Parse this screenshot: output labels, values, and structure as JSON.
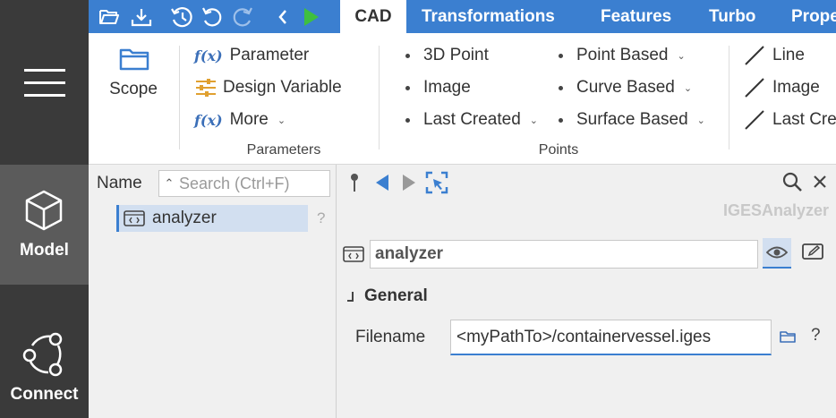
{
  "rail": {
    "model_label": "Model",
    "connect_label": "Connect"
  },
  "tabs": [
    {
      "label": "CAD"
    },
    {
      "label": "Transformations"
    },
    {
      "label": "Features"
    },
    {
      "label": "Turbo"
    },
    {
      "label": "Prope"
    }
  ],
  "ribbon": {
    "scope_label": "Scope",
    "fx_symbol": "f(x)",
    "parameter_label": "Parameter",
    "design_variable_label": "Design Variable",
    "more_label": "More",
    "parameters_group": "Parameters",
    "point_3d_label": "3D Point",
    "image_label": "Image",
    "last_created_label": "Last Created",
    "point_based_label": "Point Based",
    "curve_based_label": "Curve Based",
    "surface_based_label": "Surface Based",
    "points_group": "Points",
    "line_label": "Line",
    "line_image_label": "Image",
    "line_last_created_label": "Last Cre"
  },
  "tree": {
    "name_header": "Name",
    "search_placeholder": "Search (Ctrl+F)",
    "item_label": "analyzer",
    "help_mark": "?"
  },
  "props": {
    "type_name": "IGESAnalyzer",
    "name_value": "analyzer",
    "section_title": "General",
    "filename_label": "Filename",
    "filename_value": "<myPathTo>/containervessel.iges",
    "help_mark": "?"
  },
  "colors": {
    "accent": "#3b7fd0",
    "rail": "#3a3a3a",
    "rail_active": "#5b5b5b",
    "play_green": "#3fbf3f",
    "selection": "#d2dff0"
  },
  "icons": [
    "hamburger-icon",
    "cube-icon",
    "connect-graph-icon",
    "open-folder-icon",
    "download-icon",
    "history-icon",
    "undo-icon",
    "redo-icon",
    "back-chevron-icon",
    "play-icon",
    "scope-folder-icon",
    "fx-icon",
    "sliders-icon",
    "line-icon",
    "code-node-icon",
    "pin-icon",
    "prev-arrow-icon",
    "next-arrow-icon",
    "select-target-icon",
    "search-icon",
    "close-icon",
    "eye-icon",
    "edit-icon",
    "folder-icon"
  ]
}
